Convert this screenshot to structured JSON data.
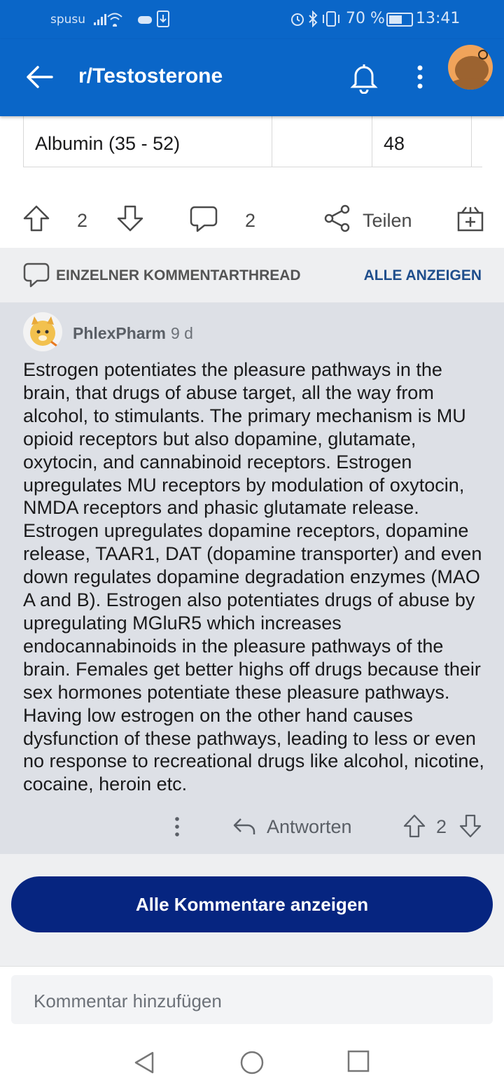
{
  "status": {
    "carrier": "spusu",
    "battery": "70 %",
    "battery_level": 0.7,
    "time": "13:41"
  },
  "header": {
    "title": "r/Testosterone"
  },
  "table": {
    "row": [
      "Albumin (35 - 52)",
      "",
      "48"
    ]
  },
  "post_actions": {
    "upvotes": "2",
    "comments": "2",
    "share": "Teilen"
  },
  "thread": {
    "label": "EINZELNER KOMMENTARTHREAD",
    "show_all": "ALLE ANZEIGEN"
  },
  "comment": {
    "author": "PhlexPharm",
    "age": "9 d",
    "body": "Estrogen potentiates the pleasure pathways in the brain, that drugs of abuse target, all the way from alcohol, to stimulants. The primary mechanism is MU opioid receptors but also dopamine, glutamate, oxytocin, and cannabinoid receptors. Estrogen upregulates MU receptors by modulation of oxytocin, NMDA receptors and phasic glutamate release. Estrogen upregulates dopamine receptors, dopamine release, TAAR1, DAT (dopamine transporter) and even down regulates dopamine degradation enzymes (MAO A and B). Estrogen also potentiates drugs of abuse by upregulating MGluR5 which increases endocannabinoids in the pleasure pathways of the brain. Females get better highs off drugs because their sex hormones potentiate these pleasure pathways. Having low estrogen on the other hand causes dysfunction of these pathways, leading to less or even no response to recreational drugs like alcohol, nicotine, cocaine, heroin etc.",
    "reply": "Antworten",
    "score": "2"
  },
  "show_all_comments": "Alle Kommentare anzeigen",
  "composer": {
    "placeholder": "Kommentar hinzufügen"
  },
  "colors": {
    "brand_blue": "#0a66c8",
    "button_navy": "#062580",
    "link_blue": "#1f4e8c"
  }
}
